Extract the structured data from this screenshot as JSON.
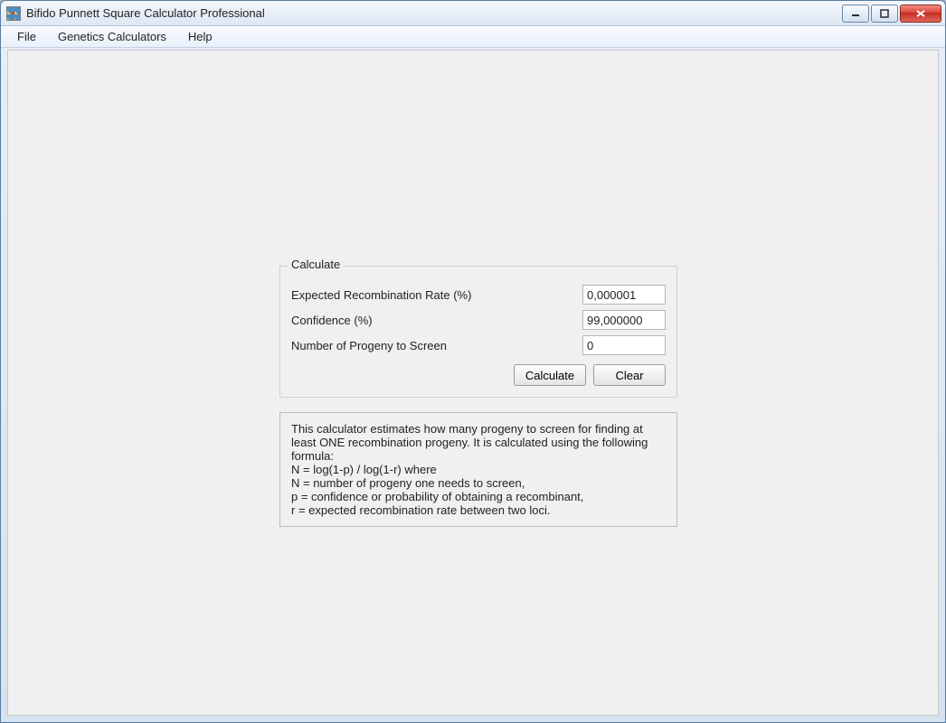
{
  "window": {
    "title": "Bifido Punnett Square Calculator Professional"
  },
  "menu": {
    "file": "File",
    "genetics": "Genetics Calculators",
    "help": "Help"
  },
  "group": {
    "title": "Calculate",
    "rate_label": "Expected Recombination Rate (%)",
    "rate_value": "0,000001",
    "conf_label": "Confidence (%)",
    "conf_value": "99,000000",
    "prog_label": "Number of Progeny to Screen",
    "prog_value": "0",
    "calculate_btn": "Calculate",
    "clear_btn": "Clear"
  },
  "info_text": "This calculator estimates how many progeny to screen for finding at least ONE recombination progeny. It is calculated using the following formula:\nN = log(1-p) / log(1-r) where\nN = number of progeny one needs to screen,\np = confidence or probability of obtaining a recombinant,\nr = expected recombination rate between two loci."
}
